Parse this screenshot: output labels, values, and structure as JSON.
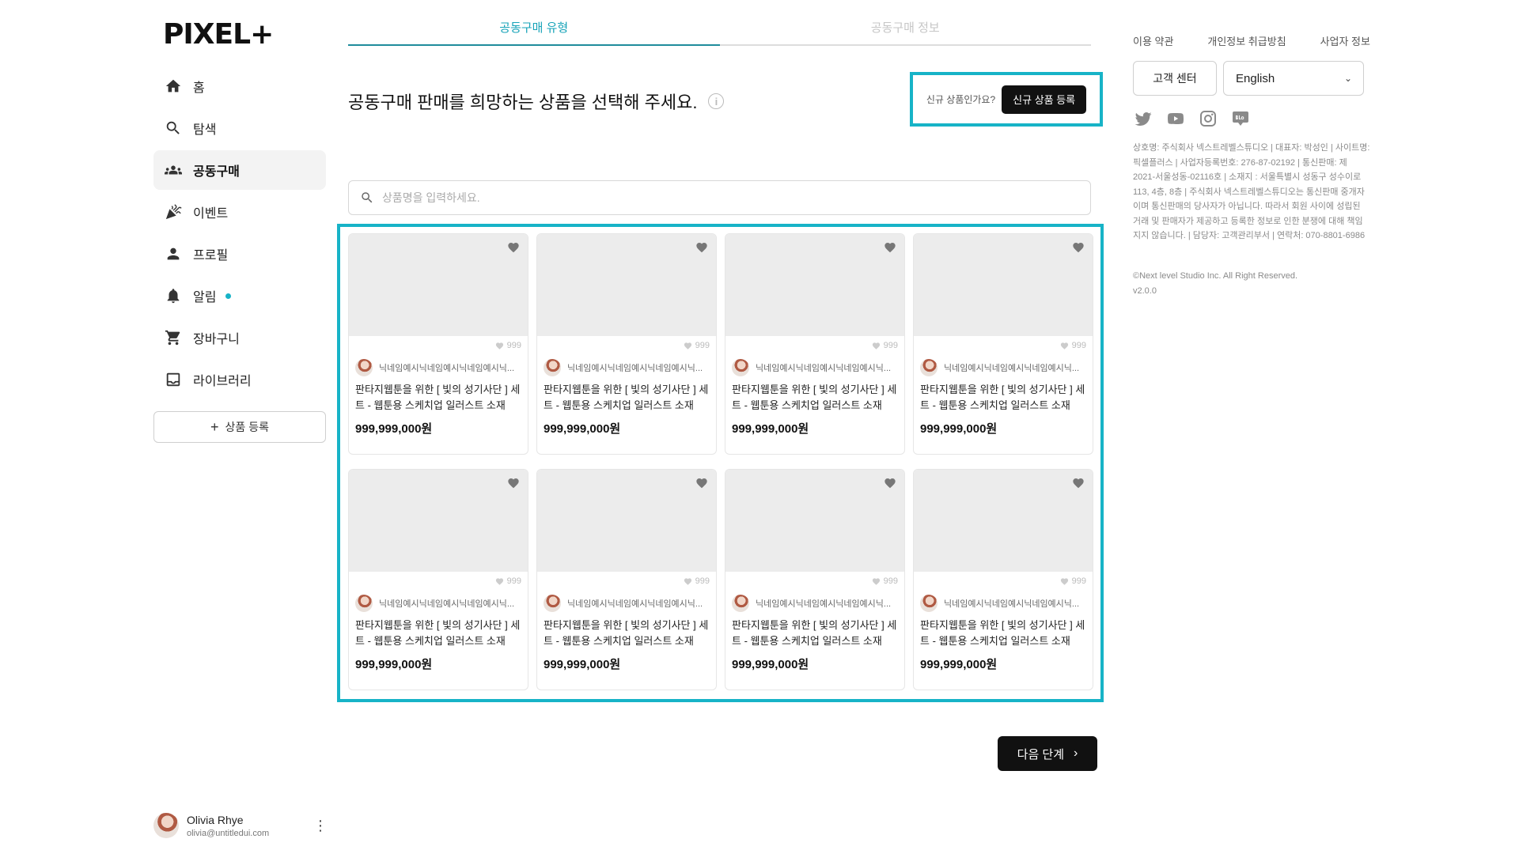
{
  "brand": {
    "logo": "PIXEL+"
  },
  "sidebar": {
    "items": [
      {
        "label": "홈",
        "icon": "home-icon"
      },
      {
        "label": "탐색",
        "icon": "search-icon"
      },
      {
        "label": "공동구매",
        "icon": "group-icon",
        "active": true
      },
      {
        "label": "이벤트",
        "icon": "party-icon"
      },
      {
        "label": "프로필",
        "icon": "person-icon"
      },
      {
        "label": "알림",
        "icon": "bell-icon",
        "has_dot": true
      },
      {
        "label": "장바구니",
        "icon": "cart-icon"
      },
      {
        "label": "라이브러리",
        "icon": "inbox-icon"
      }
    ],
    "add_product_label": "상품 등록"
  },
  "user": {
    "name": "Olivia Rhye",
    "email": "olivia@untitledui.com"
  },
  "tabs": [
    {
      "label": "공동구매 유형",
      "active": true
    },
    {
      "label": "공동구매 정보",
      "active": false
    }
  ],
  "main": {
    "heading": "공동구매 판매를 희망하는 상품을 선택해 주세요.",
    "new_product_question": "신규 상품인가요?",
    "new_product_button": "신규 상품 등록",
    "search_placeholder": "상품명을 입력하세요.",
    "next_button": "다음 단계",
    "products": [
      {
        "likes": "999",
        "seller": "닉네임예시닉네임예시닉네임예시닉...",
        "title": "판타지웹툰을 위한 [ 빛의 성기사단 ] 세트 - 웹툰용 스케치업 일러스트 소재",
        "price": "999,999,000원"
      },
      {
        "likes": "999",
        "seller": "닉네임예시닉네임예시닉네임예시닉...",
        "title": "판타지웹툰을 위한 [ 빛의 성기사단 ] 세트 - 웹툰용 스케치업 일러스트 소재",
        "price": "999,999,000원"
      },
      {
        "likes": "999",
        "seller": "닉네임예시닉네임예시닉네임예시닉...",
        "title": "판타지웹툰을 위한 [ 빛의 성기사단 ] 세트 - 웹툰용 스케치업 일러스트 소재",
        "price": "999,999,000원"
      },
      {
        "likes": "999",
        "seller": "닉네임예시닉네임예시닉네임예시닉...",
        "title": "판타지웹툰을 위한 [ 빛의 성기사단 ] 세트 - 웹툰용 스케치업 일러스트 소재",
        "price": "999,999,000원"
      },
      {
        "likes": "999",
        "seller": "닉네임예시닉네임예시닉네임예시닉...",
        "title": "판타지웹툰을 위한 [ 빛의 성기사단 ] 세트 - 웹툰용 스케치업 일러스트 소재",
        "price": "999,999,000원"
      },
      {
        "likes": "999",
        "seller": "닉네임예시닉네임예시닉네임예시닉...",
        "title": "판타지웹툰을 위한 [ 빛의 성기사단 ] 세트 - 웹툰용 스케치업 일러스트 소재",
        "price": "999,999,000원"
      },
      {
        "likes": "999",
        "seller": "닉네임예시닉네임예시닉네임예시닉...",
        "title": "판타지웹툰을 위한 [ 빛의 성기사단 ] 세트 - 웹툰용 스케치업 일러스트 소재",
        "price": "999,999,000원"
      },
      {
        "likes": "999",
        "seller": "닉네임예시닉네임예시닉네임예시닉...",
        "title": "판타지웹툰을 위한 [ 빛의 성기사단 ] 세트 - 웹툰용 스케치업 일러스트 소재",
        "price": "999,999,000원"
      }
    ]
  },
  "right": {
    "links": [
      "이용 약관",
      "개인정보 취급방침",
      "사업자 정보"
    ],
    "customer_center": "고객 센터",
    "language": "English",
    "socials": [
      "twitter-icon",
      "youtube-icon",
      "instagram-icon",
      "blog-icon"
    ],
    "company_info": "상호명: 주식회사 넥스트레벨스튜디오 | 대표자: 박성인 | 사이트명: 픽셀플러스 | 사업자등록번호: 276-87-02192 | 통신판매: 제 2021-서울성동-02116호 | 소재지 : 서울특별시 성동구 성수이로 113, 4층, 8층 | 주식회사 넥스트레벨스튜디오는 통신판매 중개자이며 통신판매의 당사자가 아닙니다. 따라서 회원 사이에 성립된 거래 및 판매자가 제공하고 등록한 정보로 인한 분쟁에 대해 책임지지 않습니다. | 담당자: 고객관리부서 | 연락처: 070-8801-6986",
    "copyright": "©Next level Studio Inc. All Right Reserved.",
    "version": "v2.0.0"
  },
  "colors": {
    "accent": "#17b3c7",
    "tab_active": "#17a3b8",
    "button_dark": "#111111"
  }
}
